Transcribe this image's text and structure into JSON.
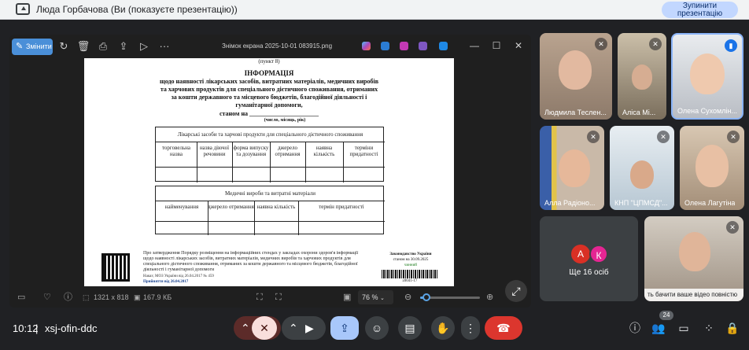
{
  "topbar": {
    "presenter_text": "Люда Горбачова (Ви (показуєте презентацію))",
    "stop_button": "Зупинити презентацію"
  },
  "viewer": {
    "edit_label": "Змінити",
    "file_name": "Знімок екрана 2025-10-01 083915.png",
    "dimensions": "1321 x 818",
    "file_size": "167.9 КБ",
    "zoom": "76 %",
    "zoom_level_fraction": 0.76,
    "doc": {
      "top_note": "(пункт 8)",
      "title": "ІНФОРМАЦІЯ",
      "line1": "щодо наявності лікарських засобів, витратних матеріалів, медичних виробів",
      "line2": "та харчових продуктів для спеціального дієтичного споживання, отриманих",
      "line3": "за кошти державного та місцевого бюджетів, благодійної діяльності і",
      "line4": "гуманітарної допомоги,",
      "line5": "станом на ______________________",
      "line6": "(число, місяць, рік)",
      "table1_header": "Лікарські засоби та харчові продукти для спеціального дієтичного споживання",
      "table1_cols": [
        "торговельна назва",
        "назва діючої речовини",
        "форма випуску та дозування",
        "джерело отримання",
        "наявна кількість",
        "терміни придатності"
      ],
      "table2_header": "Медичні вироби та витратні матеріали",
      "table2_cols": [
        "найменування",
        "джерело отримання",
        "наявна кількість",
        "термін придатності"
      ],
      "footer_text": "Про затвердження Порядку розміщення на інформаційних стендах у закладах охорони здоров'я інформації щодо наявності лікарських засобів, витратних матеріалів, медичних виробів та харчових продуктів для спеціального дієтичного споживання, отриманих за кошти державного та місцевого бюджетів, благодійної діяльності і гуманітарної допомоги",
      "footer_small": "Наказ; МОЗ України від 26.04.2017 № 459",
      "footer_date": "Прийняття від 26.04.2017",
      "legal_title": "Законодавство України",
      "legal_date": "станом на 30.09.2025",
      "legal_status": "чинний",
      "barcode_num": "z0041-17"
    }
  },
  "participants": [
    {
      "name": "Людмила Теслен...",
      "muted": true
    },
    {
      "name": "Аліса Мі...",
      "muted": true
    },
    {
      "name": "Олена Сухомлін...",
      "muted": false
    },
    {
      "name": "Алла Радіоно...",
      "muted": true
    },
    {
      "name": "КНП \"ЦПМСД\"...",
      "muted": true
    },
    {
      "name": "Олена Лагутіна",
      "muted": true
    },
    {
      "name": "",
      "muted": true
    }
  ],
  "others": {
    "avatars": [
      "А",
      "К"
    ],
    "label": "Ще 16 осіб",
    "avatar_colors": [
      "#d93025",
      "#e52592"
    ]
  },
  "self_banner": "ть бачити ваше відео повністю",
  "controls": {
    "time": "10:12",
    "separator": "|",
    "meeting_code": "xsj-ofin-ddc",
    "people_badge": "24"
  }
}
